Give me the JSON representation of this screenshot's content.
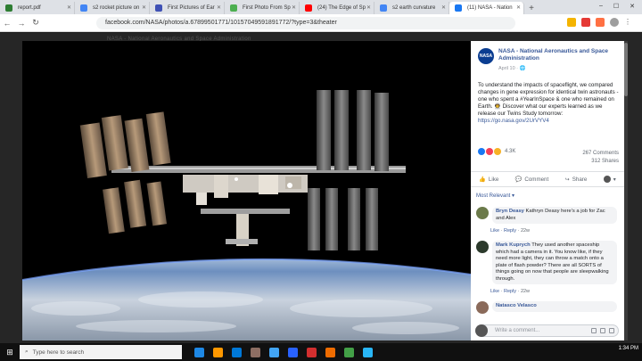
{
  "browser": {
    "tabs": [
      {
        "title": "report.pdf",
        "color": "#2e7d32"
      },
      {
        "title": "s2 rocket picture on",
        "color": "#4285f4"
      },
      {
        "title": "First Pictures of Ear",
        "color": "#3f51b5"
      },
      {
        "title": "First Photo From Sp",
        "color": "#4caf50"
      },
      {
        "title": "(24) The Edge of Sp",
        "color": "#ff0000"
      },
      {
        "title": "s2 earth curvature",
        "color": "#4285f4"
      },
      {
        "title": "(11) NASA - Nation",
        "color": "#1877f2"
      }
    ],
    "url": "facebook.com/NASA/photos/a.67899501771/10157049591891772/?type=3&theater",
    "window_controls": [
      "–",
      "☐",
      "✕"
    ]
  },
  "viewer": {
    "top_link": "NASA - National Aeronautics and Space Administration"
  },
  "post": {
    "page_name": "NASA - National Aeronautics and Space Administration",
    "avatar_text": "NASA",
    "date": "April 10 · ",
    "caption": "To understand the impacts of spaceflight, we compared changes in gene expression for identical twin astronauts - one who spent a #YearInSpace & one who remained on Earth. 👨‍🚀 Discover what our experts learned as we release our Twins Study tomorrow: ",
    "caption_link": "https://go.nasa.gov/2UrVYV4",
    "reaction_count": "4.3K",
    "reaction_colors": [
      "#1877f2",
      "#f33e58",
      "#f7b125"
    ],
    "comments_count": "267 Comments",
    "shares_count": "312 Shares",
    "actions": {
      "like": "Like",
      "comment": "Comment",
      "share": "Share"
    },
    "sort_label": "Most Relevant ▾",
    "write_placeholder": "Write a comment..."
  },
  "comments": [
    {
      "name": "Bryn Deasy",
      "text": "Kathryn Deasy here's a job for Zac and Alex",
      "like": "Like",
      "reply": "Reply",
      "time": "22w",
      "avatar_color": "#6b7a4a"
    },
    {
      "name": "Mark Kuprych",
      "text": "They used another spaceship which had a camera in it. You know like, if they need more light, they can throw a match onto a plate of flash powder? There are all SORTS of things going on now that people are sleepwalking through.",
      "like": "Like",
      "reply": "Reply",
      "time": "22w",
      "avatar_color": "#2c3a2c"
    },
    {
      "name": "Natasco Velasco",
      "text": "",
      "avatar_color": "#8a6a5a"
    }
  ],
  "taskbar": {
    "search_placeholder": "Type here to search",
    "time": "1:34 PM",
    "date": "",
    "app_colors": [
      "#1e88e5",
      "#ff9800",
      "#0078d7",
      "#8d6e63",
      "#42a5f5",
      "#2962ff",
      "#d32f2f",
      "#ef6c00",
      "#43a047",
      "#29b6f6"
    ]
  }
}
